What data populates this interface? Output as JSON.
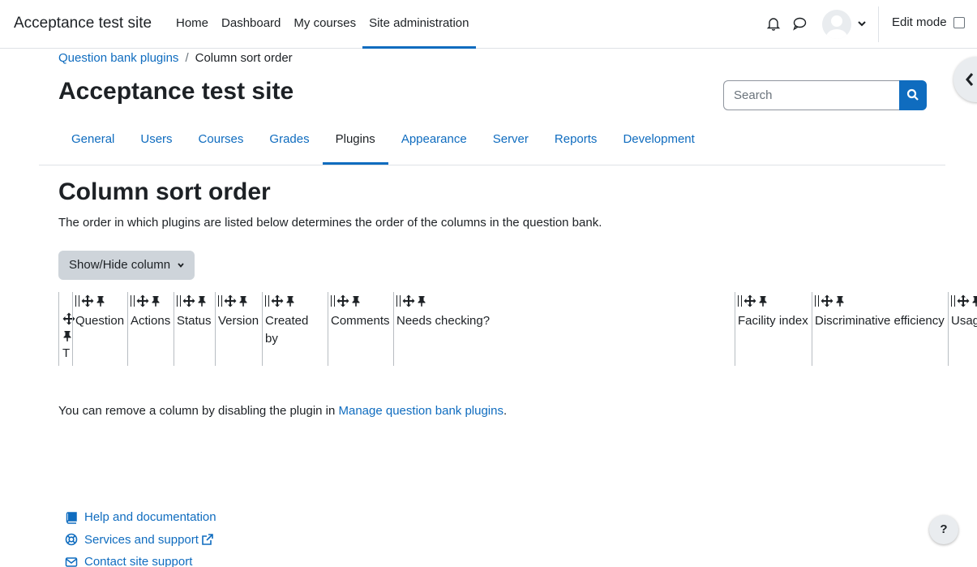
{
  "navbar": {
    "brand": "Acceptance test site",
    "items": [
      {
        "label": "Home",
        "active": false
      },
      {
        "label": "Dashboard",
        "active": false
      },
      {
        "label": "My courses",
        "active": false
      },
      {
        "label": "Site administration",
        "active": true
      }
    ],
    "edit_mode_label": "Edit mode"
  },
  "breadcrumb": {
    "parent": "Question bank plugins",
    "separator": "/",
    "current": "Column sort order"
  },
  "site_title": "Acceptance test site",
  "search": {
    "placeholder": "Search"
  },
  "secondary_nav": {
    "tabs": [
      "General",
      "Users",
      "Courses",
      "Grades",
      "Plugins",
      "Appearance",
      "Server",
      "Reports",
      "Development"
    ],
    "active": "Plugins"
  },
  "page": {
    "heading": "Column sort order",
    "description": "The order in which plugins are listed below determines the order of the columns in the question bank.",
    "show_hide_label": "Show/Hide column"
  },
  "columns": {
    "first_label": "T",
    "items": [
      "Question",
      "Actions",
      "Status",
      "Version",
      "Created by",
      "Comments",
      "Needs checking?",
      "Facility index",
      "Discriminative efficiency",
      "Usag"
    ]
  },
  "remove_note": {
    "prefix": "You can remove a column by disabling the plugin in ",
    "link": "Manage question bank plugins",
    "suffix": "."
  },
  "footer": {
    "help": "Help and documentation",
    "services": "Services and support",
    "contact": "Contact site support"
  },
  "help_button": "?",
  "colors": {
    "accent": "#0f6cbf",
    "button_gray": "#ced4da"
  }
}
